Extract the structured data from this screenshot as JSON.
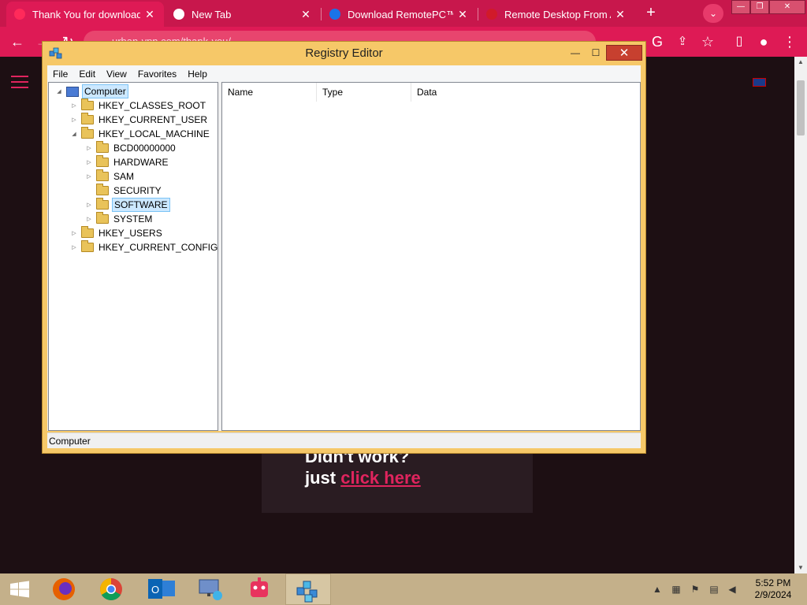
{
  "browser": {
    "tabs": [
      {
        "title": "Thank You for downloading",
        "active": true,
        "favicon_color": "#ff2a5a"
      },
      {
        "title": "New Tab",
        "active": false,
        "favicon_color": "#ffffff"
      },
      {
        "title": "Download RemotePC™ (Fo",
        "active": false,
        "favicon_color": "#1a73e8"
      },
      {
        "title": "Remote Desktop From An",
        "active": false,
        "favicon_color": "#d11a2a"
      }
    ],
    "tab_close_glyph": "✕",
    "new_tab_glyph": "+",
    "address": "urban-vpn.com/thank-you/",
    "accent_color": "#de1a55"
  },
  "page": {
    "card_line1": "Didn't work?",
    "card_line2_prefix": "just ",
    "card_link": "click here"
  },
  "regedit": {
    "title": "Registry Editor",
    "min_glyph": "—",
    "max_glyph": "☐",
    "close_glyph": "✕",
    "menu": [
      "File",
      "Edit",
      "View",
      "Favorites",
      "Help"
    ],
    "tree": [
      {
        "label": "Computer",
        "depth": 0,
        "expander": "◢",
        "icon": "computer",
        "selected": true
      },
      {
        "label": "HKEY_CLASSES_ROOT",
        "depth": 1,
        "expander": "▷"
      },
      {
        "label": "HKEY_CURRENT_USER",
        "depth": 1,
        "expander": "▷"
      },
      {
        "label": "HKEY_LOCAL_MACHINE",
        "depth": 1,
        "expander": "◢"
      },
      {
        "label": "BCD00000000",
        "depth": 2,
        "expander": "▷"
      },
      {
        "label": "HARDWARE",
        "depth": 2,
        "expander": "▷"
      },
      {
        "label": "SAM",
        "depth": 2,
        "expander": "▷"
      },
      {
        "label": "SECURITY",
        "depth": 2,
        "expander": ""
      },
      {
        "label": "SOFTWARE",
        "depth": 2,
        "expander": "▷",
        "highlighted": true
      },
      {
        "label": "SYSTEM",
        "depth": 2,
        "expander": "▷"
      },
      {
        "label": "HKEY_USERS",
        "depth": 1,
        "expander": "▷"
      },
      {
        "label": "HKEY_CURRENT_CONFIG",
        "depth": 1,
        "expander": "▷"
      }
    ],
    "columns": [
      "Name",
      "Type",
      "Data"
    ],
    "status": "Computer"
  },
  "taskbar": {
    "apps": [
      "start",
      "firefox",
      "chrome",
      "outlook",
      "remote-desktop",
      "robot-app",
      "regedit"
    ],
    "time": "5:52 PM",
    "date": "2/9/2024"
  }
}
